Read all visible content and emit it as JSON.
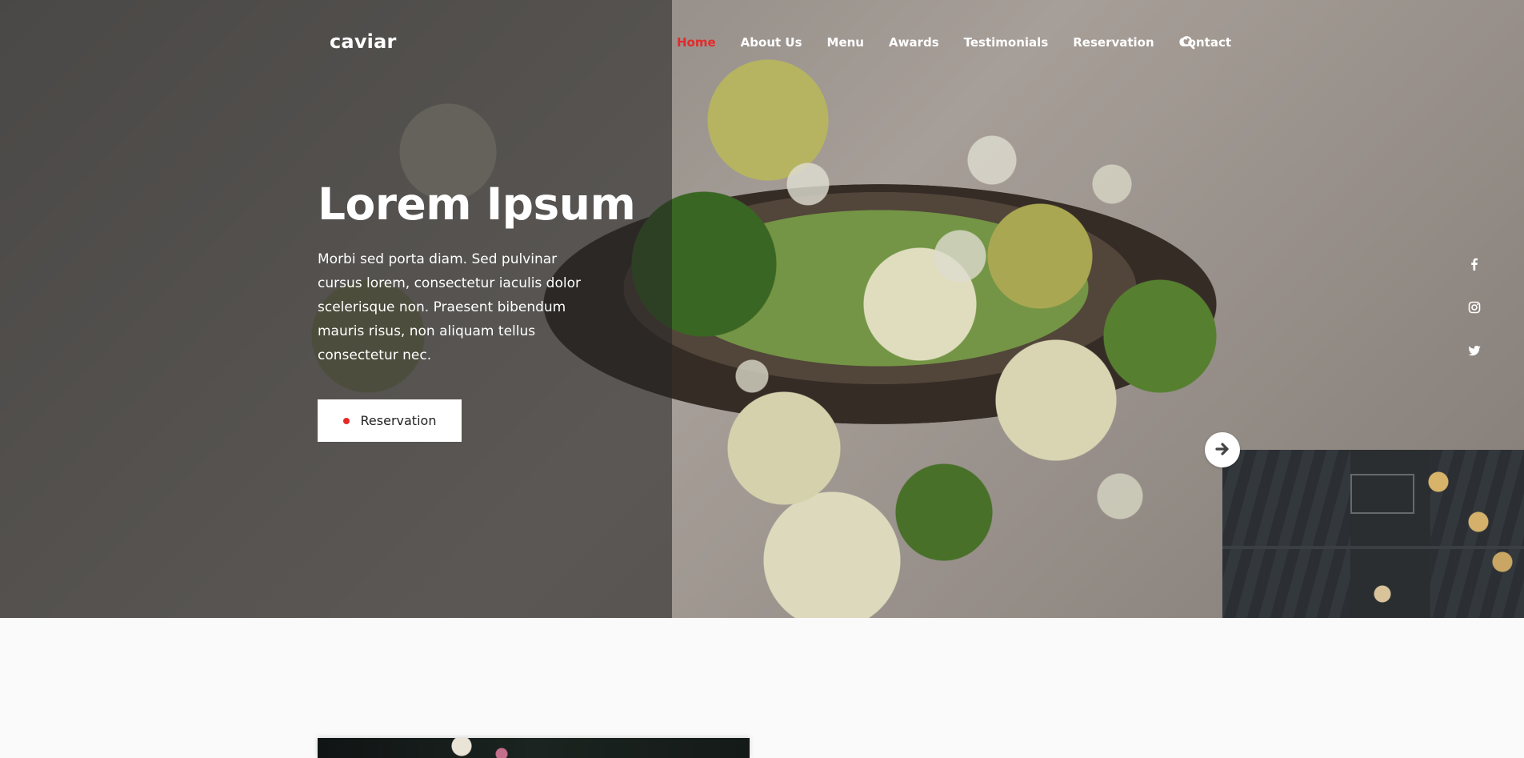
{
  "brand": {
    "logo": "caviar"
  },
  "nav": {
    "items": [
      {
        "label": "Home",
        "active": true
      },
      {
        "label": "About Us",
        "active": false
      },
      {
        "label": "Menu",
        "active": false
      },
      {
        "label": "Awards",
        "active": false
      },
      {
        "label": "Testimonials",
        "active": false
      },
      {
        "label": "Reservation",
        "active": false
      },
      {
        "label": "Contact",
        "active": false
      }
    ],
    "search_icon": "search-icon"
  },
  "hero": {
    "title": "Lorem Ipsum",
    "text": "Morbi sed porta diam. Sed pulvinar cursus lorem, consectetur iaculis dolor scelerisque non. Praesent bibendum mauris risus, non aliquam tellus consectetur nec.",
    "button_label": "Reservation",
    "next_icon": "arrow-right-icon"
  },
  "social": [
    "facebook-icon",
    "instagram-icon",
    "twitter-icon"
  ],
  "colors": {
    "accent": "#e42a2a",
    "overlay": "#232323",
    "page_bg": "#fafafa",
    "text_light": "#ffffff"
  }
}
